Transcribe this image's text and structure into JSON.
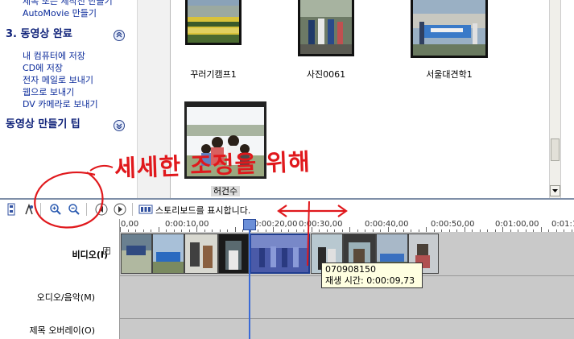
{
  "task_pane": {
    "link_top_1": "제목 또는 제작진 만들기",
    "link_top_2": "AutoMovie 만들기",
    "section3_title": "3. 동영상 완료",
    "section3_links": [
      "내 컴퓨터에 저장",
      "CD에 저장",
      "전자 메일로 보내기",
      "웹으로 보내기",
      "DV 카메라로 보내기"
    ],
    "tips_title": "동영상 만들기 팁"
  },
  "collection": {
    "clips": [
      {
        "caption": "꾸러기캠프1"
      },
      {
        "caption": "사진0061"
      },
      {
        "caption": "서울대견학1"
      },
      {
        "caption": "허건수",
        "selected": true
      }
    ]
  },
  "timeline": {
    "toolbar": {
      "toggle_label": "스토리보드를 표시합니다."
    },
    "ruler_labels": [
      "0,00",
      "0:00:10,00",
      "0:00:20,00",
      "0:00:30,00",
      "0:00:40,00",
      "0:00:50,00",
      "0:01:00,00",
      "0:01:1"
    ],
    "tracks": {
      "video": "비디오(I)",
      "audio": "오디오/음악(M)",
      "title_overlay": "제목 오버레이(O)"
    },
    "tooltip": {
      "name": "070908150",
      "duration_label": "재생 시간:",
      "duration": "0:00:09,73"
    }
  },
  "annotation": {
    "text": "세세한 조정을 위해",
    "color": "#e0181c"
  },
  "icons": [
    "storyboard-timeline-icon",
    "narrate-icon",
    "zoom-in-icon",
    "zoom-out-icon",
    "rewind-icon",
    "play-icon",
    "storyboard-icon"
  ]
}
